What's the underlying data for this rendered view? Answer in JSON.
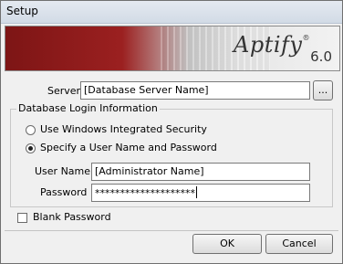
{
  "window": {
    "title": "Setup"
  },
  "banner": {
    "logo_text": "Aptify",
    "logo_mark": "®",
    "version": "6.0"
  },
  "server": {
    "label": "Server",
    "value": "[Database Server Name]",
    "browse_label": "..."
  },
  "login": {
    "group_title": "Database Login Information",
    "windows_security_label": "Use Windows Integrated Security",
    "windows_security_selected": false,
    "user_password_label": "Specify a User Name and Password",
    "user_password_selected": true,
    "username_label": "User Name",
    "username_value": "[Administrator Name]",
    "password_label": "Password",
    "password_value": "********************"
  },
  "blank_password": {
    "label": "Blank Password",
    "checked": false
  },
  "buttons": {
    "ok_label": "OK",
    "cancel_label": "Cancel"
  }
}
